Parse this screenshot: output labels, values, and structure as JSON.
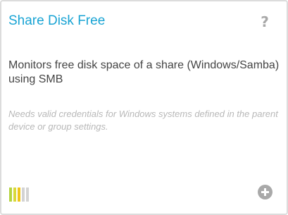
{
  "card": {
    "title": "Share Disk Free",
    "description": "Monitors free disk space of a share (Windows/Samba) using SMB",
    "note": "Needs valid credentials for Windows systems defined in the parent device or group settings.",
    "help_icon": "question-mark-icon",
    "add_icon": "plus-circle-icon",
    "performance_level": 3,
    "performance_max": 5,
    "performance_colors": [
      "#b5d43f",
      "#d9d93a",
      "#f0c419",
      "#d3d3d3",
      "#d3d3d3"
    ],
    "title_color": "#1aa4d4"
  }
}
